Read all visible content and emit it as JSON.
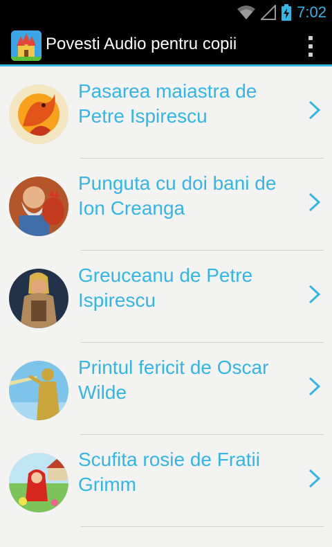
{
  "status_bar": {
    "time": "7:02",
    "icons": [
      "wifi-icon",
      "signal-icon",
      "battery-charging-icon"
    ],
    "accent_color": "#33b5e5"
  },
  "action_bar": {
    "title": "Povesti Audio pentru copii",
    "app_icon": "castle-app-icon",
    "overflow_icon": "overflow-menu-icon"
  },
  "stories": [
    {
      "title": "Pasarea maiastra de Petre Ispirescu",
      "thumbnail": "firebird-thumbnail"
    },
    {
      "title": "Punguta cu doi bani de Ion Creanga",
      "thumbnail": "old-man-rooster-thumbnail"
    },
    {
      "title": "Greuceanu de Petre Ispirescu",
      "thumbnail": "hero-warrior-thumbnail"
    },
    {
      "title": "Printul fericit de Oscar Wilde",
      "thumbnail": "happy-prince-statue-thumbnail"
    },
    {
      "title": "Scufita rosie de Fratii Grimm",
      "thumbnail": "red-riding-hood-thumbnail"
    }
  ],
  "list_colors": {
    "title_color": "#33b5e5",
    "background": "#f3f3f1",
    "divider": "#cfcfcf"
  }
}
